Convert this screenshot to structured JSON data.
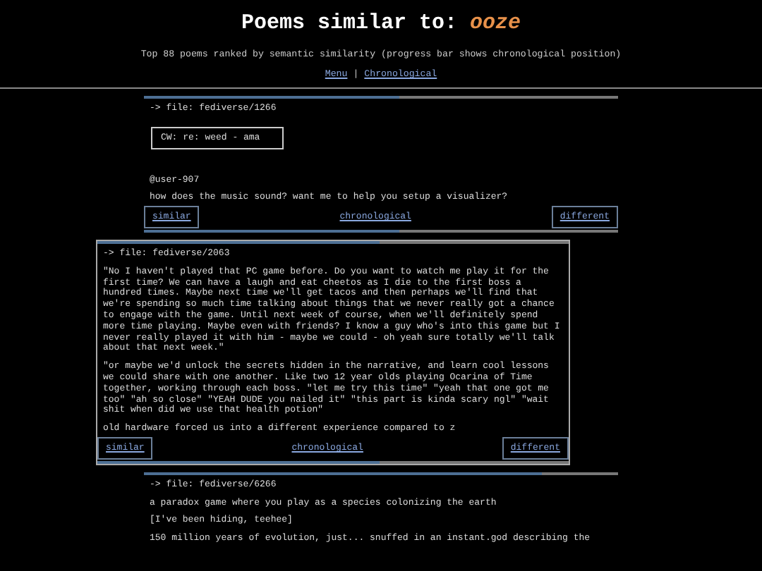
{
  "header": {
    "title": "Poems similar to:",
    "query": "ooze",
    "subtitle": "Top 88 poems ranked by semantic similarity (progress bar shows chronological position)",
    "nav": [
      {
        "label": "Menu"
      },
      {
        "label": "Chronological"
      }
    ],
    "separator": "|"
  },
  "poems": [
    {
      "file": "-> file: fediverse/1266",
      "level": 0.54,
      "highlighted": false,
      "cw": "CW: re: weed - ama",
      "paragraphs": [
        "@user-907",
        "how does the music sound? want me to help you setup a visualizer?"
      ],
      "actions": [
        "similar",
        "chronological",
        "different"
      ]
    },
    {
      "file": "-> file: fediverse/2063",
      "level": 0.6,
      "highlighted": true,
      "paragraphs": [
        "\"No I haven't played that PC game before. Do you want to watch me play it for the first time? We can have a laugh and eat cheetos as I die to the first boss a hundred times. Maybe next time we'll get tacos and then perhaps we'll find that we're spending so much time talking about things that we never really got a chance to engage with the game. Until next week of course, when we'll definitely spend more time playing. Maybe even with friends? I know a guy who's into this game but I never really played it with him - maybe we could - oh yeah sure totally we'll talk about that next week.\"",
        "\"or maybe we'd unlock the secrets hidden in the narrative, and learn cool lessons we could share with one another. Like two 12 year olds playing Ocarina of Time together, working through each boss. \"let me try this time\" \"yeah that one got me too\" \"ah so close\" \"YEAH DUDE you nailed it\" \"this part is kinda scary ngl\" \"wait shit when did we use that health potion\"",
        "old hardware forced us into a different experience compared to z"
      ],
      "actions": [
        "similar",
        "chronological",
        "different"
      ]
    },
    {
      "file": "-> file: fediverse/6266",
      "level": 0.84,
      "highlighted": false,
      "paragraphs": [
        "a paradox game where you play as a species colonizing the earth",
        "[I've been hiding, teehee]",
        "150 million years of evolution, just... snuffed in an instant.god describing the"
      ]
    }
  ]
}
